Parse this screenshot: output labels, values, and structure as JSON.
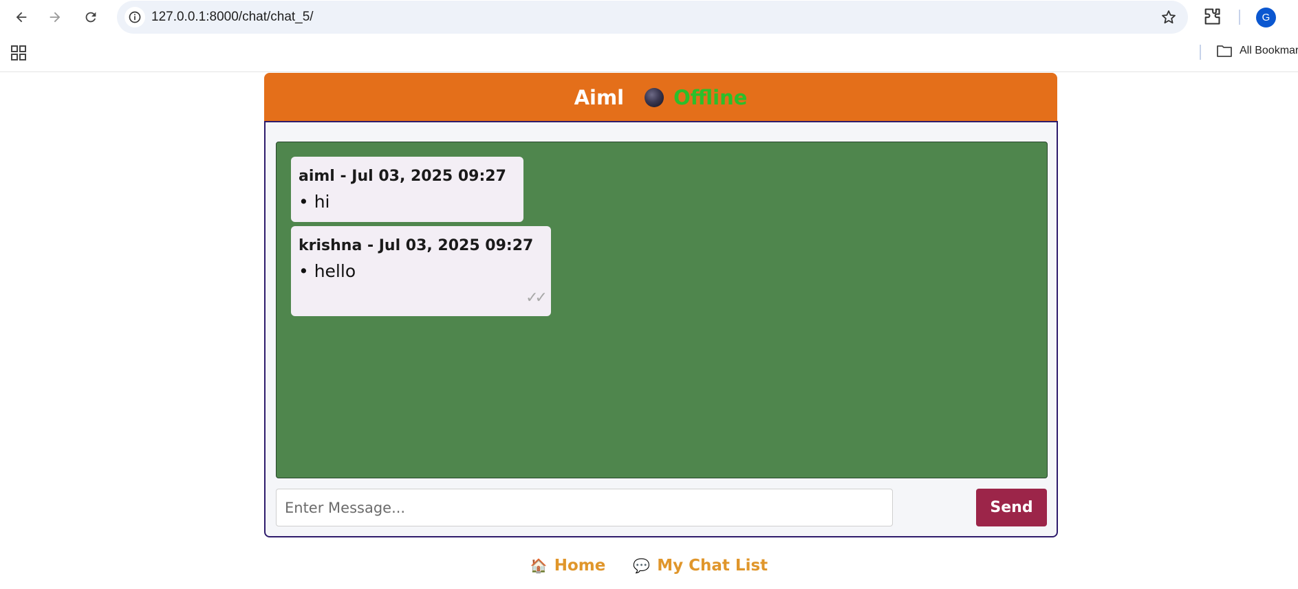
{
  "browser": {
    "url": "127.0.0.1:8000/chat/chat_5/",
    "profile_initial": "G",
    "bookmarks_label": "All Bookmarks",
    "icons": [
      "back-arrow-icon",
      "forward-arrow-icon",
      "reload-icon",
      "site-info-icon",
      "bookmark-star-icon",
      "extensions-icon",
      "apps-grid-icon",
      "folder-icon"
    ]
  },
  "chat": {
    "title": "Aiml",
    "status": "Offline",
    "colors": {
      "header": "#e46f1a",
      "status": "#2bbf2b",
      "messages_bg": "#4f864d",
      "send_button": "#9c2549",
      "links": "#e0962b"
    },
    "messages": [
      {
        "meta": "aiml - Jul 03, 2025 09:27",
        "text": "hi"
      },
      {
        "meta": "krishna - Jul 03, 2025 09:27",
        "text": "hello",
        "ticks": "✓✓"
      }
    ],
    "input_placeholder": "Enter Message...",
    "send_label": "Send"
  },
  "footer": {
    "home_icon": "🏠",
    "home_label": "Home",
    "chatlist_icon": "💬",
    "chatlist_label": "My Chat List"
  }
}
